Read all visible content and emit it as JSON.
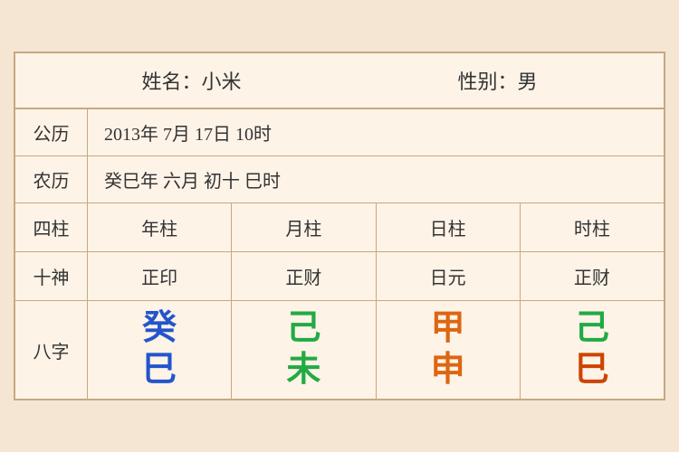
{
  "header": {
    "name_label": "姓名：小米",
    "gender_label": "性别：男"
  },
  "solar": {
    "label": "公历",
    "value": "2013年 7月 17日 10时"
  },
  "lunar": {
    "label": "农历",
    "value": "癸巳年 六月 初十 巳时"
  },
  "siZhu": {
    "label": "四柱",
    "cols": [
      "年柱",
      "月柱",
      "日柱",
      "时柱"
    ]
  },
  "shiShen": {
    "label": "十神",
    "cols": [
      "正印",
      "正财",
      "日元",
      "正财"
    ]
  },
  "baZhi": {
    "label": "八字",
    "cols": [
      {
        "top": "癸",
        "top_color": "blue",
        "bottom": "巳",
        "bottom_color": "blue"
      },
      {
        "top": "己",
        "top_color": "green",
        "bottom": "未",
        "bottom_color": "green"
      },
      {
        "top": "甲",
        "top_color": "orange",
        "bottom": "申",
        "bottom_color": "orange"
      },
      {
        "top": "己",
        "top_color": "green",
        "bottom": "巳",
        "bottom_color": "red-orange"
      }
    ]
  }
}
